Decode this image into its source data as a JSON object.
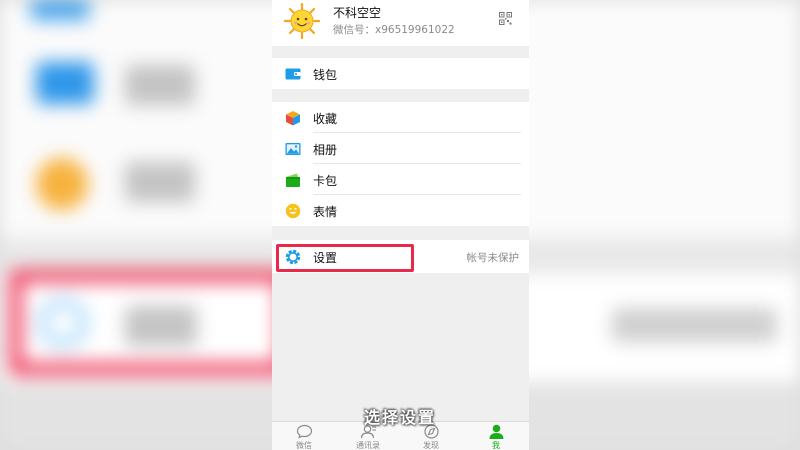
{
  "profile": {
    "name": "不科空空",
    "wechat_id": "微信号：x96519961022"
  },
  "menu": {
    "wallet": "钱包",
    "favorites": "收藏",
    "album": "相册",
    "cards": "卡包",
    "stickers": "表情",
    "settings": "设置",
    "settings_note": "帐号未保护"
  },
  "tabs": [
    {
      "label": "微信",
      "icon": "chat-icon",
      "active": false
    },
    {
      "label": "通讯录",
      "icon": "contacts-icon",
      "active": false
    },
    {
      "label": "发现",
      "icon": "compass-icon",
      "active": false
    },
    {
      "label": "我",
      "icon": "me-icon",
      "active": true
    }
  ],
  "caption": "选择设置",
  "colors": {
    "accent_green": "#1aad19",
    "highlight_red": "#e8294a",
    "wallet_blue": "#1e9be9"
  }
}
